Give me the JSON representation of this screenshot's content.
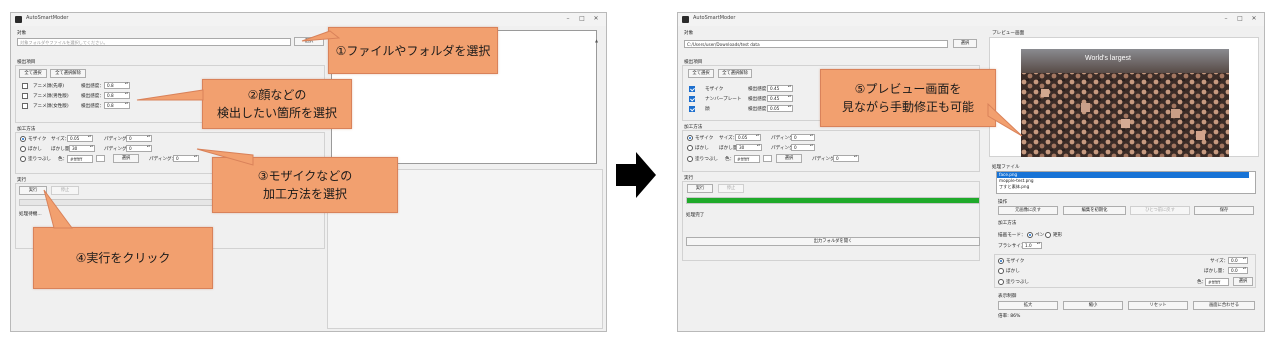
{
  "app": {
    "title": "AutoSmartModer"
  },
  "left": {
    "target_label": "対象",
    "target_placeholder": "対象フォルダやファイルを選択してください。",
    "select_btn": "選択",
    "detect_label": "検出項目",
    "select_all": "全て選択",
    "deselect_all": "全て選択解除",
    "detect_rows": [
      {
        "label": "アニメ顔(先導)",
        "sens_label": "検出感度：",
        "value": "0.8"
      },
      {
        "label": "アニメ顔(男性版)",
        "sens_label": "検出感度：",
        "value": "0.8"
      },
      {
        "label": "アニメ顔(女性版)",
        "sens_label": "検出感度：",
        "value": "0.8"
      }
    ],
    "method_label": "加工方法",
    "methods": [
      {
        "label": "モザイク",
        "param1_label": "サイズ：",
        "param1_value": "0.05",
        "param2_label": "パディング：",
        "param2_value": "0"
      },
      {
        "label": "ぼかし",
        "param1_label": "ぼかし量：",
        "param1_value": "30",
        "param2_label": "パディング：",
        "param2_value": "0"
      },
      {
        "label": "塗りつぶし",
        "param1_label": "色：",
        "param1_value": "#ffffff",
        "select": "選択",
        "param2_label": "パディング：",
        "param2_value": "0"
      }
    ],
    "run_label": "実行",
    "run_btn": "実行",
    "stop_btn": "停止",
    "status_text": "処理待機..."
  },
  "right": {
    "target_label": "対象",
    "target_value": "C:/Users/user/Downloads/test data",
    "select_btn": "選択",
    "detect_label": "検出項目",
    "select_all": "全て選択",
    "deselect_all": "全て選択解除",
    "detect_rows": [
      {
        "label": "モザイク",
        "sens_label": "検出感度：",
        "value": "0.45",
        "checked": true
      },
      {
        "label": "ナンバープレート",
        "sens_label": "検出感度：",
        "value": "0.45",
        "checked": true
      },
      {
        "label": "顔",
        "sens_label": "検出感度：",
        "value": "0.05",
        "checked": true
      }
    ],
    "method_label": "加工方法",
    "methods": [
      {
        "label": "モザイク",
        "param1_label": "サイズ：",
        "param1_value": "0.05",
        "param2_label": "パディング：",
        "param2_value": "0"
      },
      {
        "label": "ぼかし",
        "param1_label": "ぼかし量：",
        "param1_value": "30",
        "param2_label": "パディング：",
        "param2_value": "0"
      },
      {
        "label": "塗りつぶし",
        "param1_label": "色：",
        "param1_value": "#ffffff",
        "select": "選択",
        "param2_label": "パディング：",
        "param2_value": "0"
      }
    ],
    "run_label": "実行",
    "run_btn": "実行",
    "stop_btn": "停止",
    "progress": 1.0,
    "status_text": "処理完了",
    "open_output": "出力フォルダを開く",
    "preview_label": "プレビュー画面",
    "preview_image_caption": "World's largest",
    "files_label": "処理ファイル",
    "files": [
      "face.png",
      "mopple-test.png",
      "丁すと素体.png"
    ],
    "ops_label": "操作",
    "ops": [
      "元画像に戻す",
      "編集を初期化",
      "ひとつ前に戻す",
      "保存"
    ],
    "edit_label": "加工方法",
    "edit_mode_label": "描画モード：",
    "edit_mode_pen": "ペン",
    "edit_mode_rect": "矩形",
    "brush_label": "ブラシサイズ：",
    "brush_value": "1.0",
    "edit_methods": [
      {
        "label": "モザイク",
        "param_label": "サイズ：",
        "param_value": "0.0"
      },
      {
        "label": "ぼかし",
        "param_label": "ぼかし量：",
        "param_value": "0.0"
      },
      {
        "label": "塗りつぶし",
        "param_label": "色：",
        "param_value": "#ffffff",
        "select": "選択"
      }
    ],
    "view_label": "表示制御",
    "view_btns": [
      "拡大",
      "縮小",
      "リセット",
      "画面に合わせる"
    ],
    "zoom_text": "倍率: 86%"
  },
  "callouts": {
    "c1": "①ファイルやフォルダを選択",
    "c2_line1": "②顔などの",
    "c2_line2": "検出したい箇所を選択",
    "c3_line1": "③モザイクなどの",
    "c3_line2": "加工方法を選択",
    "c4": "④実行をクリック",
    "c5_line1": "⑤プレビュー画面を",
    "c5_line2": "見ながら手動修正も可能"
  },
  "colors": {
    "callout": "#f2a06f",
    "progress": "#1faa2a",
    "checkbox": "#1d6fce",
    "arrow": "#000000"
  }
}
